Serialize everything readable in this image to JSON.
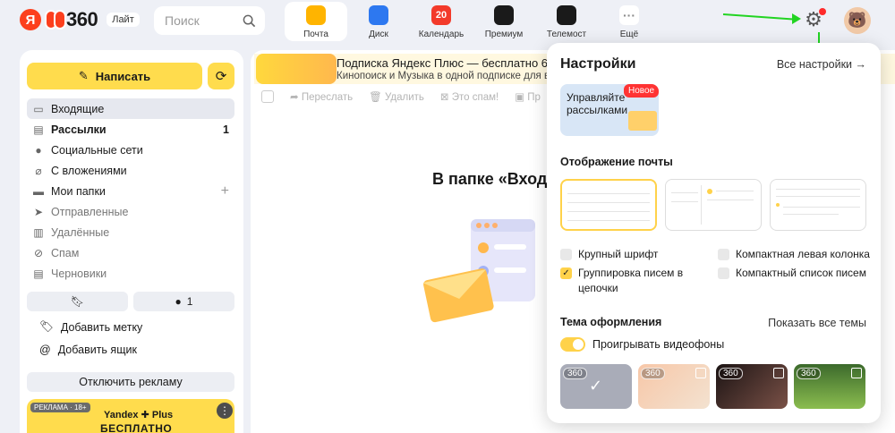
{
  "header": {
    "logo_ya": "Я",
    "logo_360": "360",
    "lite_badge": "Лайт",
    "search_placeholder": "Поиск",
    "apps": [
      {
        "label": "Почта",
        "color": "#ffb400",
        "icon": "mail-icon"
      },
      {
        "label": "Диск",
        "color": "#2d78f0",
        "icon": "disk-icon"
      },
      {
        "label": "Календарь",
        "color": "#f33a2a",
        "icon": "calendar-icon",
        "glyph": "20"
      },
      {
        "label": "Премиум",
        "color": "#1a1a1a",
        "icon": "premium-icon"
      },
      {
        "label": "Телемост",
        "color": "#1a1a1a",
        "icon": "telemost-icon"
      },
      {
        "label": "Ещё",
        "color": "#ffffff",
        "icon": "more-icon",
        "glyph": "···"
      }
    ]
  },
  "sidebar": {
    "compose_label": "Написать",
    "folders": [
      {
        "label": "Входящие",
        "icon": "inbox-icon",
        "glyph": "▭",
        "state": "active"
      },
      {
        "label": "Рассылки",
        "icon": "newsletters-icon",
        "glyph": "▤",
        "count": "1",
        "state": "bold"
      },
      {
        "label": "Социальные сети",
        "icon": "social-icon",
        "glyph": "●",
        "state": ""
      },
      {
        "label": "С вложениями",
        "icon": "attachment-icon",
        "glyph": "⌀",
        "state": ""
      },
      {
        "label": "Мои папки",
        "icon": "folder-icon",
        "glyph": "▬",
        "plus": "+",
        "state": ""
      },
      {
        "label": "Отправленные",
        "icon": "sent-icon",
        "glyph": "➤",
        "state": "muted"
      },
      {
        "label": "Удалённые",
        "icon": "trash-icon",
        "glyph": "▥",
        "state": "muted"
      },
      {
        "label": "Спам",
        "icon": "spam-icon",
        "glyph": "⊘",
        "state": "muted"
      },
      {
        "label": "Черновики",
        "icon": "drafts-icon",
        "glyph": "▤",
        "state": "muted"
      }
    ],
    "bookmark_count": "1",
    "add_label": "Добавить метку",
    "add_mailbox": "Добавить ящик",
    "disable_ads": "Отключить рекламу",
    "promo": {
      "age": "РЕКЛАМА · 18+",
      "brand": "Yandex ✚ Plus",
      "free": "БЕСПЛАТНО"
    }
  },
  "main": {
    "banner_title": "Подписка Яндекс Плюс — бесплатно 60",
    "banner_sub": "Кинопоиск и Музыка в одной подписке для в",
    "toolbar": [
      "Переслать",
      "Удалить",
      "Это спам!",
      "Пр"
    ],
    "empty_title": "В папке «Вход"
  },
  "settings": {
    "title": "Настройки",
    "all_settings": "Все настройки →",
    "card_text": "Управляйте рассылками",
    "new_badge": "Новое",
    "display_heading": "Отображение почты",
    "options": [
      {
        "label": "Крупный шрифт",
        "checked": false
      },
      {
        "label": "Компактная левая колонка",
        "checked": false
      },
      {
        "label": "Группировка писем в цепочки",
        "checked": true
      },
      {
        "label": "Компактный список писем",
        "checked": false
      }
    ],
    "theme_heading": "Тема оформления",
    "show_all_themes": "Показать все темы",
    "video_toggle_label": "Проигрывать видеофоны",
    "video_toggle_on": true,
    "themes": [
      {
        "tag": "360",
        "selected": true,
        "bg": "#a9acb8"
      },
      {
        "tag": "360",
        "selected": false,
        "bg": "linear-gradient(135deg,#f7c7a8,#f3e2d0)"
      },
      {
        "tag": "360",
        "selected": false,
        "bg": "linear-gradient(135deg,#1c1414,#7a5147)"
      },
      {
        "tag": "360",
        "selected": false,
        "bg": "linear-gradient(180deg,#3c6a2c,#8bbd4f)"
      }
    ]
  },
  "colors": {
    "accent": "#ffdc4d",
    "arrow": "#22d422",
    "badge_red": "#ff3333"
  }
}
